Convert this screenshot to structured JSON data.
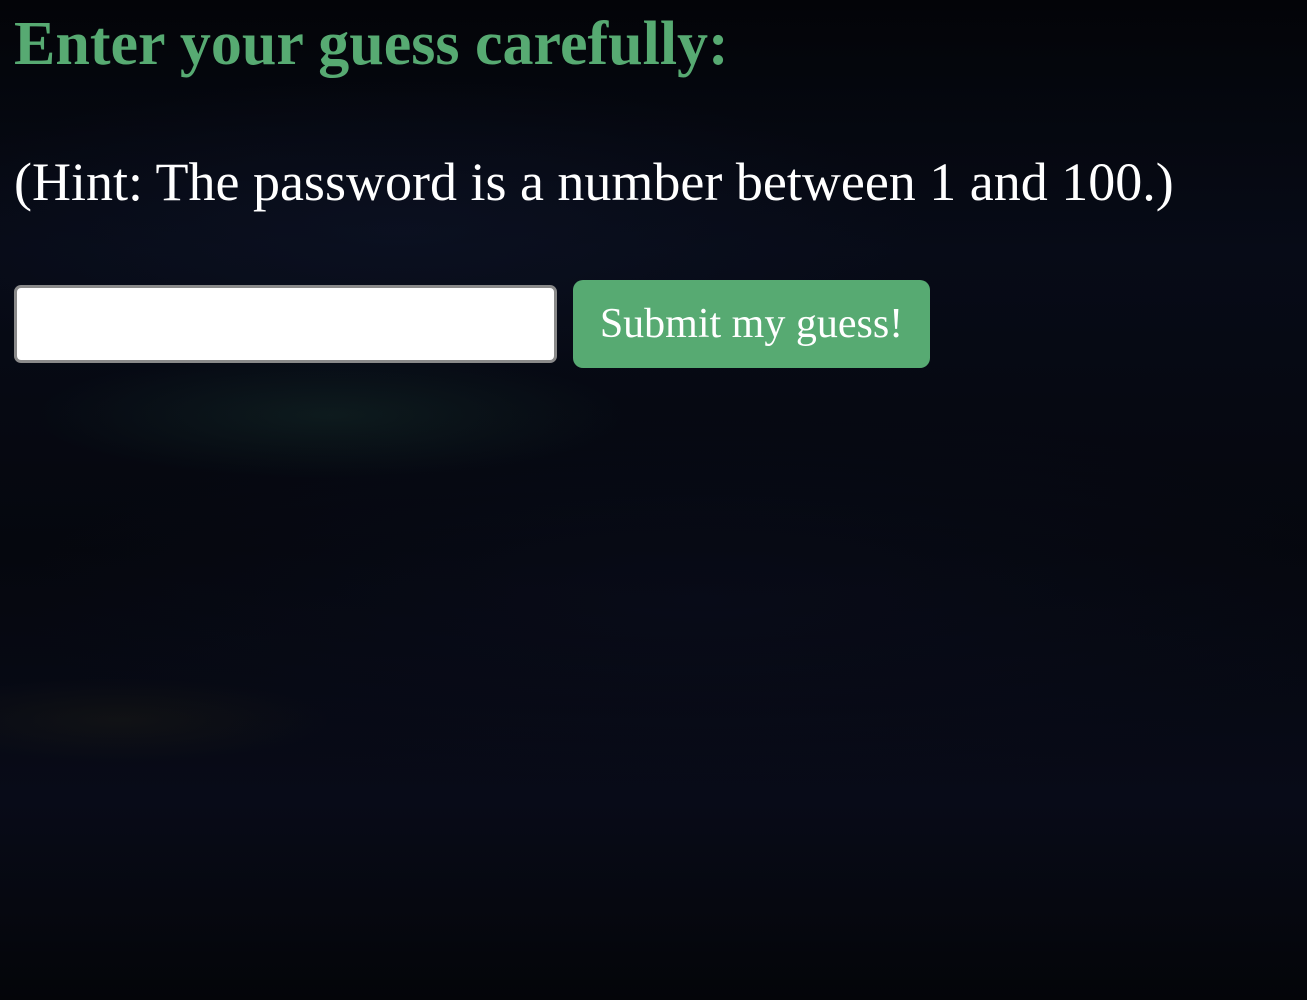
{
  "page": {
    "heading": "Enter your guess carefully:",
    "hint": "(Hint: The password is a number between 1 and 100.)"
  },
  "form": {
    "guess_value": "",
    "guess_placeholder": "",
    "submit_label": "Submit my guess!"
  },
  "colors": {
    "accent": "#57aa72",
    "background": "#04060c",
    "text": "#ffffff"
  }
}
